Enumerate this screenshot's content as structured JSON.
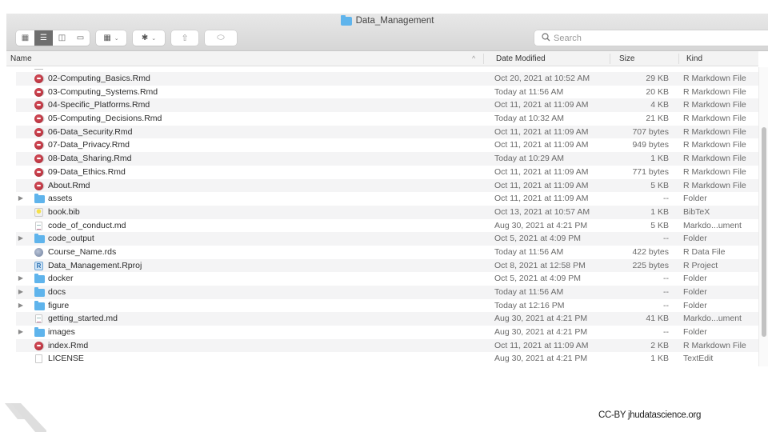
{
  "window": {
    "title": "Data_Management",
    "title_icon": "folder-icon"
  },
  "toolbar": {
    "view_buttons": [
      {
        "name": "icon-view",
        "icon": "grid-icon",
        "glyph": "▦",
        "active": false
      },
      {
        "name": "list-view",
        "icon": "list-icon",
        "glyph": "☰",
        "active": true
      },
      {
        "name": "column-view",
        "icon": "columns-icon",
        "glyph": "◫",
        "active": false
      },
      {
        "name": "gallery-view",
        "icon": "gallery-icon",
        "glyph": "▭",
        "active": false
      }
    ],
    "group_glyph": "▦",
    "action_glyph": "✱",
    "dropdown_chevron": "⌄",
    "share_glyph": "⇧",
    "tag_glyph": "⬭"
  },
  "search": {
    "placeholder": "Search",
    "value": "",
    "icon_glyph": "⚲"
  },
  "columns": {
    "name": "Name",
    "date_modified": "Date Modified",
    "size": "Size",
    "kind": "Kind",
    "sort_indicator": "^"
  },
  "files": [
    {
      "name": "02-Computing_Basics.Rmd",
      "date": "Oct 20, 2021 at 10:52 AM",
      "size": "29 KB",
      "kind": "R Markdown File",
      "type": "rmd",
      "expandable": false
    },
    {
      "name": "03-Computing_Systems.Rmd",
      "date": "Today at 11:56 AM",
      "size": "20 KB",
      "kind": "R Markdown File",
      "type": "rmd",
      "expandable": false
    },
    {
      "name": "04-Specific_Platforms.Rmd",
      "date": "Oct 11, 2021 at 11:09 AM",
      "size": "4 KB",
      "kind": "R Markdown File",
      "type": "rmd",
      "expandable": false
    },
    {
      "name": "05-Computing_Decisions.Rmd",
      "date": "Today at 10:32 AM",
      "size": "21 KB",
      "kind": "R Markdown File",
      "type": "rmd",
      "expandable": false
    },
    {
      "name": "06-Data_Security.Rmd",
      "date": "Oct 11, 2021 at 11:09 AM",
      "size": "707 bytes",
      "kind": "R Markdown File",
      "type": "rmd",
      "expandable": false
    },
    {
      "name": "07-Data_Privacy.Rmd",
      "date": "Oct 11, 2021 at 11:09 AM",
      "size": "949 bytes",
      "kind": "R Markdown File",
      "type": "rmd",
      "expandable": false
    },
    {
      "name": "08-Data_Sharing.Rmd",
      "date": "Today at 10:29 AM",
      "size": "1 KB",
      "kind": "R Markdown File",
      "type": "rmd",
      "expandable": false
    },
    {
      "name": "09-Data_Ethics.Rmd",
      "date": "Oct 11, 2021 at 11:09 AM",
      "size": "771 bytes",
      "kind": "R Markdown File",
      "type": "rmd",
      "expandable": false
    },
    {
      "name": "About.Rmd",
      "date": "Oct 11, 2021 at 11:09 AM",
      "size": "5 KB",
      "kind": "R Markdown File",
      "type": "rmd",
      "expandable": false
    },
    {
      "name": "assets",
      "date": "Oct 11, 2021 at 11:09 AM",
      "size": "--",
      "kind": "Folder",
      "type": "folder",
      "expandable": true
    },
    {
      "name": "book.bib",
      "date": "Oct 13, 2021 at 10:57 AM",
      "size": "1 KB",
      "kind": "BibTeX",
      "type": "bib",
      "expandable": false
    },
    {
      "name": "code_of_conduct.md",
      "date": "Aug 30, 2021 at 4:21 PM",
      "size": "5 KB",
      "kind": "Markdo...ument",
      "type": "md",
      "expandable": false
    },
    {
      "name": "code_output",
      "date": "Oct 5, 2021 at 4:09 PM",
      "size": "--",
      "kind": "Folder",
      "type": "folder",
      "expandable": true
    },
    {
      "name": "Course_Name.rds",
      "date": "Today at 11:56 AM",
      "size": "422 bytes",
      "kind": "R Data File",
      "type": "rds",
      "expandable": false
    },
    {
      "name": "Data_Management.Rproj",
      "date": "Oct 8, 2021 at 12:58 PM",
      "size": "225 bytes",
      "kind": "R Project",
      "type": "rproj",
      "expandable": false
    },
    {
      "name": "docker",
      "date": "Oct 5, 2021 at 4:09 PM",
      "size": "--",
      "kind": "Folder",
      "type": "folder",
      "expandable": true
    },
    {
      "name": "docs",
      "date": "Today at 11:56 AM",
      "size": "--",
      "kind": "Folder",
      "type": "folder",
      "expandable": true
    },
    {
      "name": "figure",
      "date": "Today at 12:16 PM",
      "size": "--",
      "kind": "Folder",
      "type": "folder",
      "expandable": true
    },
    {
      "name": "getting_started.md",
      "date": "Aug 30, 2021 at 4:21 PM",
      "size": "41 KB",
      "kind": "Markdo...ument",
      "type": "md",
      "expandable": false
    },
    {
      "name": "images",
      "date": "Aug 30, 2021 at 4:21 PM",
      "size": "--",
      "kind": "Folder",
      "type": "folder",
      "expandable": true
    },
    {
      "name": "index.Rmd",
      "date": "Oct 11, 2021 at 11:09 AM",
      "size": "2 KB",
      "kind": "R Markdown File",
      "type": "rmd",
      "expandable": false
    },
    {
      "name": "LICENSE",
      "date": "Aug 30, 2021 at 4:21 PM",
      "size": "1 KB",
      "kind": "TextEdit",
      "type": "txt",
      "expandable": false
    }
  ],
  "disclosure_glyph": "▶",
  "rproj_glyph": "R",
  "scroll": {
    "position_fraction": 0.2,
    "visible_fraction": 0.7
  },
  "footer": {
    "credit": "CC-BY jhudatascience.org"
  },
  "colors": {
    "folder": "#5fb4ec",
    "rmd": "#c0303c",
    "row_alt": "#f4f4f5"
  }
}
